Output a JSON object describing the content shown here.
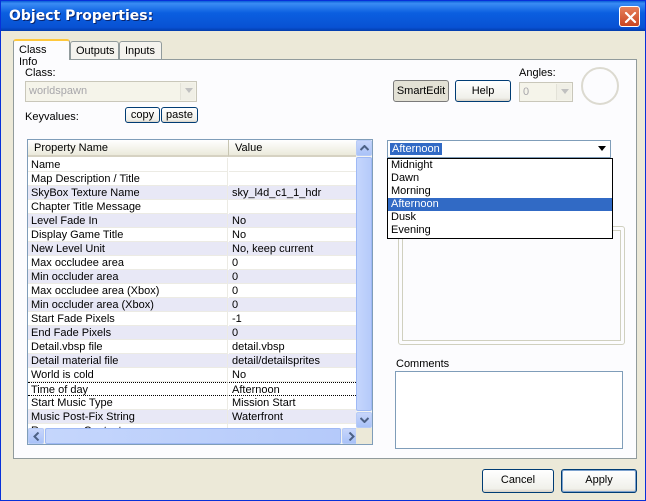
{
  "window": {
    "title": "Object Properties:"
  },
  "tabs": [
    {
      "label": "Class Info",
      "active": true
    },
    {
      "label": "Outputs",
      "active": false
    },
    {
      "label": "Inputs",
      "active": false
    }
  ],
  "class_section": {
    "label": "Class:",
    "value": "worldspawn",
    "keyvalues_label": "Keyvalues:",
    "copy_label": "copy",
    "paste_label": "paste"
  },
  "toolbar": {
    "smartedit_label": "SmartEdit",
    "help_label": "Help",
    "angles_label": "Angles:",
    "angles_value": "0"
  },
  "grid": {
    "columns": [
      "Property Name",
      "Value"
    ],
    "rows": [
      {
        "name": "Name",
        "value": ""
      },
      {
        "name": "Map Description / Title",
        "value": ""
      },
      {
        "name": "SkyBox Texture Name",
        "value": "sky_l4d_c1_1_hdr"
      },
      {
        "name": "Chapter Title Message",
        "value": ""
      },
      {
        "name": "Level Fade In",
        "value": "No"
      },
      {
        "name": "Display Game Title",
        "value": "No"
      },
      {
        "name": "New Level Unit",
        "value": "No, keep current"
      },
      {
        "name": "Max occludee area",
        "value": "0"
      },
      {
        "name": "Min occluder area",
        "value": "0"
      },
      {
        "name": "Max occludee area (Xbox)",
        "value": "0"
      },
      {
        "name": "Min occluder area (Xbox)",
        "value": "0"
      },
      {
        "name": "Start Fade Pixels",
        "value": "-1"
      },
      {
        "name": "End Fade Pixels",
        "value": "0"
      },
      {
        "name": "Detail.vbsp file",
        "value": "detail.vbsp"
      },
      {
        "name": "Detail material file",
        "value": "detail/detailsprites"
      },
      {
        "name": "World is cold",
        "value": "No"
      },
      {
        "name": "Time of day",
        "value": "Afternoon"
      },
      {
        "name": "Start Music Type",
        "value": "Mission Start"
      },
      {
        "name": "Music Post-Fix String",
        "value": "Waterfront"
      },
      {
        "name": "Response Context",
        "value": ""
      }
    ],
    "selected_row": 16
  },
  "value_dropdown": {
    "selected": "Afternoon",
    "options": [
      "Midnight",
      "Dawn",
      "Morning",
      "Afternoon",
      "Dusk",
      "Evening"
    ],
    "highlighted_index": 3
  },
  "comments": {
    "label": "Comments"
  },
  "footer": {
    "cancel_label": "Cancel",
    "apply_label": "Apply"
  }
}
